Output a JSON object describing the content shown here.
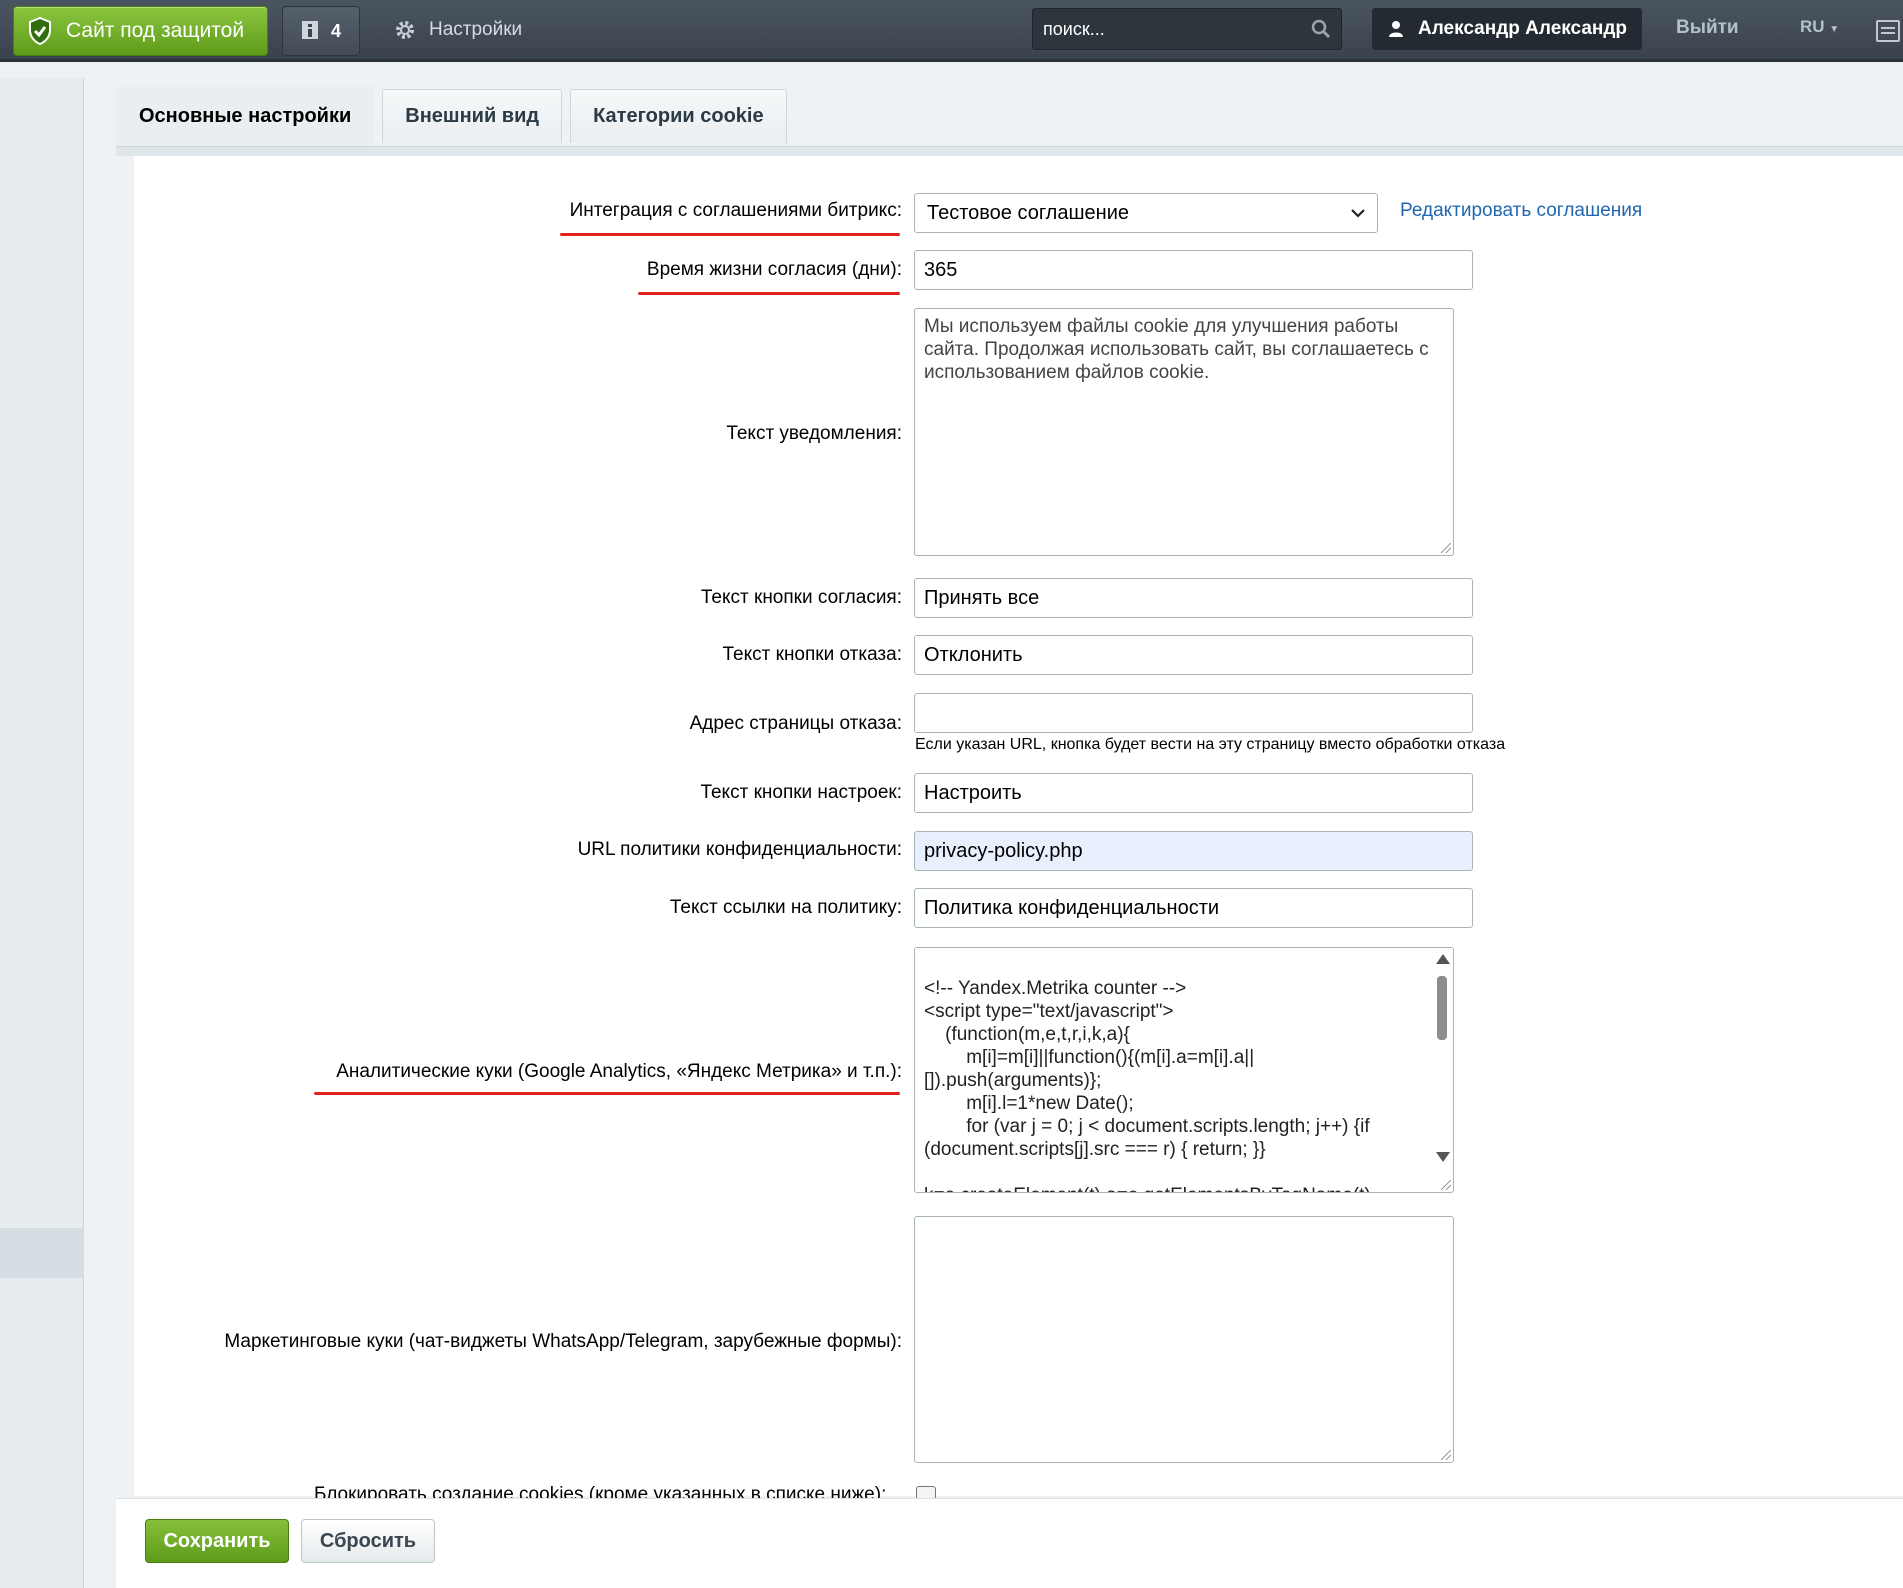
{
  "topbar": {
    "secure_label": "Сайт под защитой",
    "notifications_count": "4",
    "settings_label": "Настройки",
    "search_placeholder": "поиск...",
    "user_name": "Александр Александр",
    "logout_label": "Выйти",
    "lang_label": "RU"
  },
  "tabs": [
    "Основные настройки",
    "Внешний вид",
    "Категории cookie"
  ],
  "form": {
    "agreement_label": "Интеграция с соглашениями битрикс:",
    "agreement_value": "Тестовое соглашение",
    "agreement_link": "Редактировать соглашения",
    "lifetime_label": "Время жизни согласия (дни):",
    "lifetime_value": "365",
    "notice_label": "Текст уведомления:",
    "notice_value": "Мы используем файлы cookie для улучшения работы сайта. Продолжая использовать сайт, вы соглашаетесь с использованием файлов cookie.",
    "accept_label": "Текст кнопки согласия:",
    "accept_value": "Принять все",
    "decline_label": "Текст кнопки отказа:",
    "decline_value": "Отклонить",
    "decline_url_label": "Адрес страницы отказа:",
    "decline_url_value": "",
    "decline_url_hint": "Если указан URL, кнопка будет вести на эту страницу вместо обработки отказа",
    "settings_btn_label": "Текст кнопки настроек:",
    "settings_btn_value": "Настроить",
    "policy_url_label": "URL политики конфиденциальности:",
    "policy_url_value": "privacy-policy.php",
    "policy_link_label": "Текст ссылки на политику:",
    "policy_link_value": "Политика конфиденциальности",
    "analytics_label": "Аналитические куки (Google Analytics, «Яндекс Метрика» и т.п.):",
    "analytics_code": "\n<!-- Yandex.Metrika counter -->\n<script type=\"text/javascript\">\n    (function(m,e,t,r,i,k,a){\n        m[i]=m[i]||function(){(m[i].a=m[i].a||\n[]).push(arguments)};\n        m[i].l=1*new Date();\n        for (var j = 0; j < document.scripts.length; j++) {if\n(document.scripts[j].src === r) { return; }}\n\nk=e.createElement(t),a=e.getElementsByTagName(t)",
    "marketing_label": "Маркетинговые куки (чат-виджеты WhatsApp/Telegram, зарубежные формы):",
    "marketing_value": "",
    "block_label": "Блокировать создание cookies (кроме указанных в списке ниже):"
  },
  "footer": {
    "save_label": "Сохранить",
    "reset_label": "Сбросить"
  },
  "colors": {
    "accent_green": "#5e9b1a",
    "link_blue": "#2067b0",
    "highlight_red": "#e3221d"
  }
}
